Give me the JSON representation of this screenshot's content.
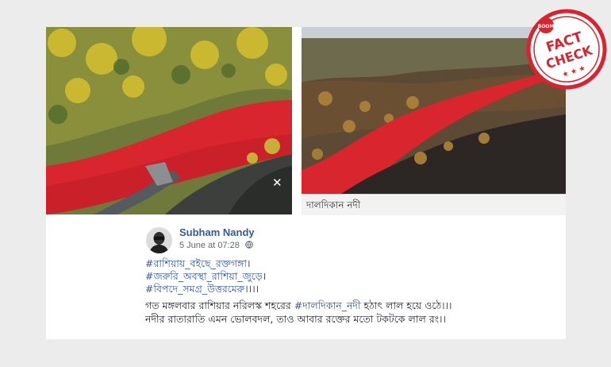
{
  "post": {
    "author": "Subham Nandy",
    "timestamp": "5 June at 07:28",
    "hashtags": [
      "#রাশিয়ায়_বইছে_রক্তগঙ্গা",
      "#জরুরি_অবস্থা_রাশিয়া_জুড়ে",
      "#বিপদে_সমগ্র_উত্তরমেরু"
    ],
    "hashtag_tails": [
      "।",
      "।",
      "।।।।"
    ],
    "text_line1_before": "গত মঙ্গলবার রাশিয়ার নরিলস্ক শহরের ",
    "text_line1_tag": "#দালদিকান_নদী",
    "text_line1_after": " হঠাৎ লাল হয়ে ওঠে।।।",
    "text_line2": "নদীর রাতারাতি এমন ভোলবদল, তাও আবার রক্তের মতো টকটকে লাল রং।।"
  },
  "photo_right_caption": "দালদিকান নদী",
  "close_glyph": "✕",
  "stamp": {
    "brand": "BOOM",
    "word1": "FACT",
    "word2": "CHECK",
    "color": "#d9232e"
  },
  "colors": {
    "link": "#385898",
    "river": "#d8252e"
  }
}
